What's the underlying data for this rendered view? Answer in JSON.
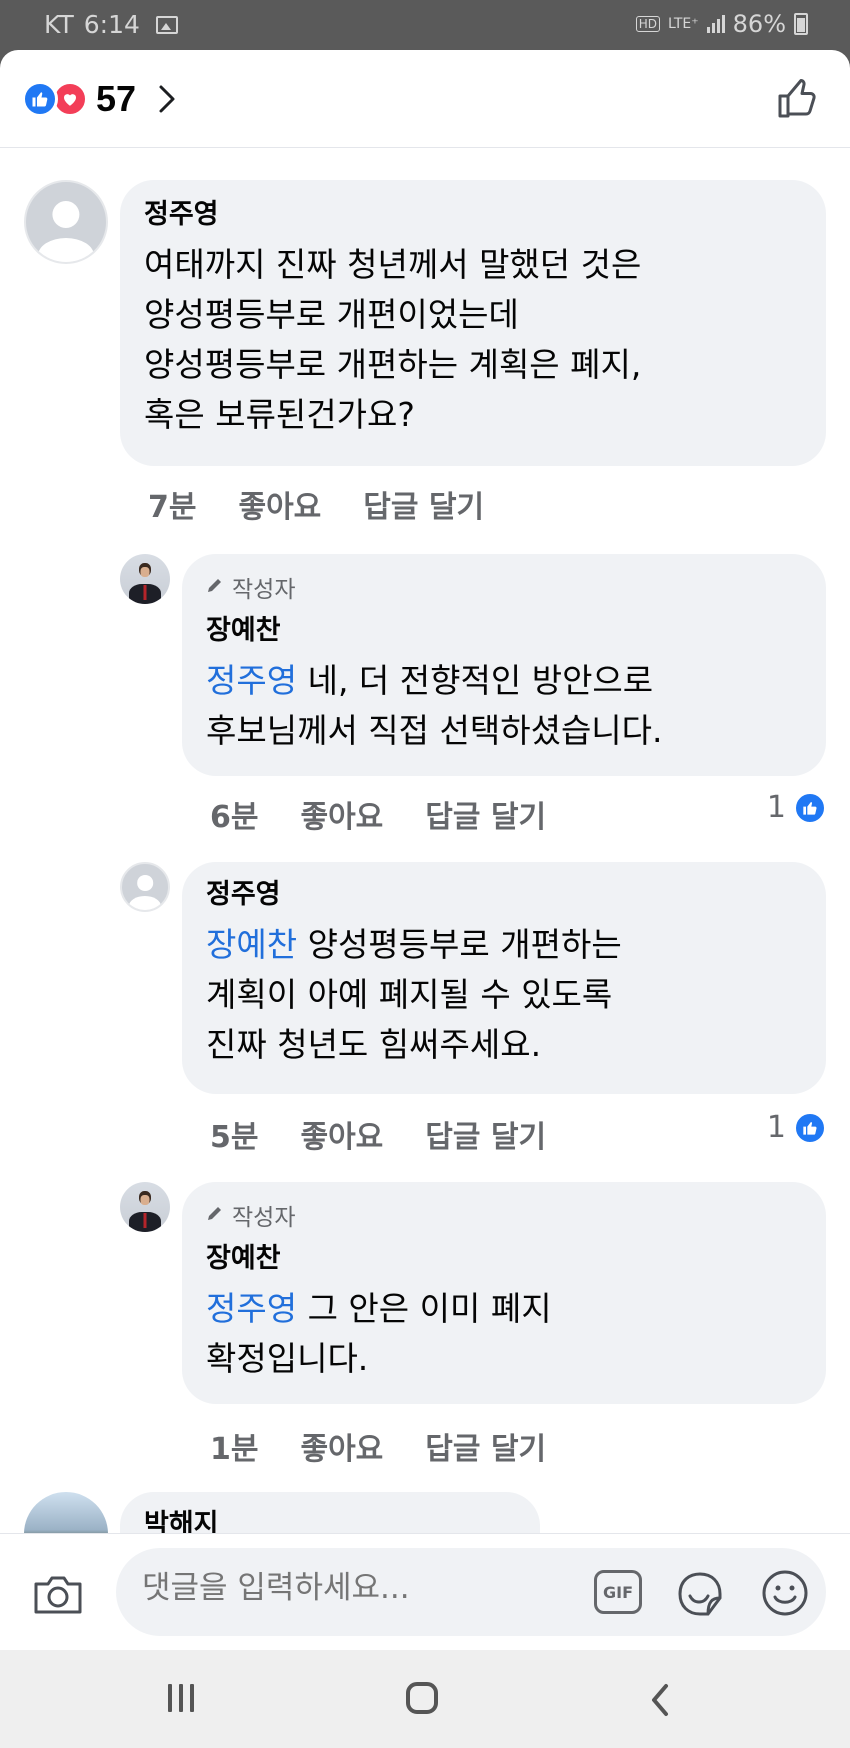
{
  "status_bar": {
    "carrier": "KT",
    "time": "6:14",
    "hd_label": "HD",
    "network": "LTE⁺",
    "battery": "86%"
  },
  "header": {
    "reaction_count": "57"
  },
  "comments": [
    {
      "name": "정주영",
      "text": "여태까지 진짜 청년께서 말했던 것은\n양성평등부로 개편이었는데\n양성평등부로 개편하는 계획은 폐지,\n혹은 보류된건가요?",
      "time": "7분",
      "like_label": "좋아요",
      "reply_label": "답글 달기"
    },
    {
      "badge": "작성자",
      "name": "장예찬",
      "mention": "정주영",
      "text": " 네, 더 전향적인 방안으로\n후보님께서 직접 선택하셨습니다.",
      "time": "6분",
      "like_label": "좋아요",
      "reply_label": "답글 달기",
      "likes": "1"
    },
    {
      "name": "정주영",
      "mention": "장예찬",
      "text": " 양성평등부로 개편하는\n계획이 아예 폐지될 수 있도록\n진짜 청년도 힘써주세요.",
      "time": "5분",
      "like_label": "좋아요",
      "reply_label": "답글 달기",
      "likes": "1"
    },
    {
      "badge": "작성자",
      "name": "장예찬",
      "mention": "정주영",
      "text": " 그 안은 이미 폐지\n확정입니다.",
      "time": "1분",
      "like_label": "좋아요",
      "reply_label": "답글 달기"
    },
    {
      "name": "박해지"
    }
  ],
  "composer": {
    "placeholder": "댓글을 입력하세요...",
    "gif_label": "GIF"
  },
  "colors": {
    "accent": "#2078f4",
    "mention": "#216fdb",
    "love": "#f33e58",
    "bubble": "#f0f2f5"
  },
  "icons": [
    "like-icon",
    "love-icon",
    "chevron-right-icon",
    "thumbs-up-icon",
    "pencil-icon",
    "camera-icon",
    "gif-icon",
    "sticker-icon",
    "emoji-icon",
    "recent-apps-icon",
    "home-icon",
    "back-icon"
  ]
}
